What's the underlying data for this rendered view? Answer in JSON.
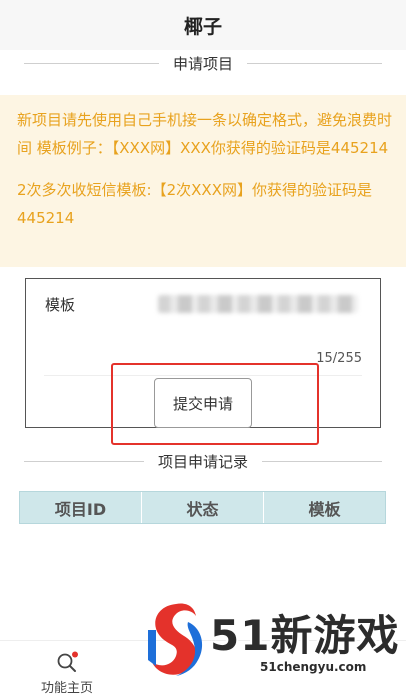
{
  "app": {
    "title": "椰子"
  },
  "apply_section": {
    "title": "申请项目"
  },
  "notice": {
    "line1": "新项目请先使用自己手机接一条以确定格式，避免浪费时间 模板例子：【XXX网】XXX你获得的验证码是445214",
    "line2": "2次多次收短信模板:【2次XXX网】你获得的验证码是445214"
  },
  "form": {
    "template_label": "模板",
    "counter": "15/255",
    "submit_label": "提交申请"
  },
  "records_section": {
    "title": "项目申请记录"
  },
  "records_table": {
    "columns": [
      "项目ID",
      "状态",
      "模板"
    ]
  },
  "tabbar": {
    "home_label": "功能主页",
    "home_icon": "search-icon"
  },
  "watermark": {
    "brand": "51新游戏",
    "url": "51chengyu.com"
  },
  "colors": {
    "notice_text": "#e8a21e",
    "notice_bg": "#fdf5e3",
    "table_header_bg": "#cfe7ea",
    "highlight": "#e4322b",
    "badge": "#e4322b"
  }
}
